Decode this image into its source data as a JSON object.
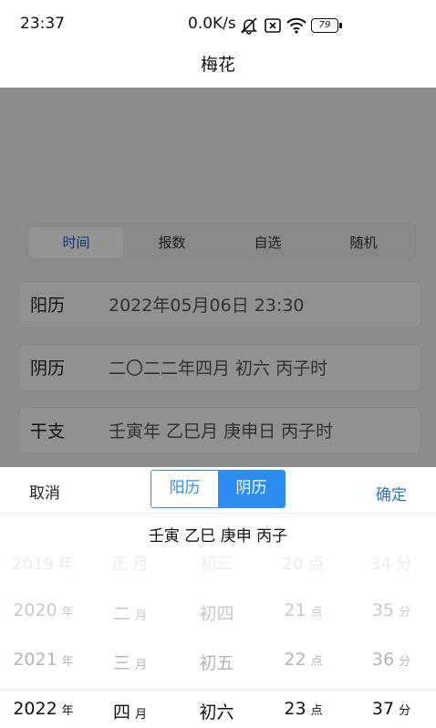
{
  "status": {
    "time": "23:37",
    "speed": "0.0K/s",
    "icons": [
      "mute-notification-icon",
      "sim-x-icon",
      "wifi-icon"
    ],
    "battery": "79"
  },
  "title": "梅花",
  "tabs": [
    {
      "label": "时间",
      "active": true
    },
    {
      "label": "报数",
      "active": false
    },
    {
      "label": "自选",
      "active": false
    },
    {
      "label": "随机",
      "active": false
    }
  ],
  "fields": {
    "solar": {
      "label": "阳历",
      "value": "2022年05月06日 23:30"
    },
    "lunar": {
      "label": "阴历",
      "value": "二〇二二年四月 初六 丙子时"
    },
    "ganzhi": {
      "label": "干支",
      "value": "壬寅年 乙巳月 庚申日 丙子时"
    }
  },
  "picker": {
    "cancel": "取消",
    "confirm": "确定",
    "segments": [
      {
        "label": "阳历",
        "active": false
      },
      {
        "label": "阴历",
        "active": true
      }
    ],
    "ganzhi_text": "壬寅 乙巳 庚申 丙子",
    "columns": {
      "year": {
        "unit": "年",
        "values": [
          "2019",
          "2020",
          "2021",
          "2022"
        ]
      },
      "month": {
        "unit": "月",
        "values": [
          "正",
          "二",
          "三",
          "四"
        ]
      },
      "day": {
        "unit": "",
        "values": [
          "初三",
          "初四",
          "初五",
          "初六"
        ]
      },
      "hour": {
        "unit": "点",
        "values": [
          "20",
          "21",
          "22",
          "23"
        ]
      },
      "minute": {
        "unit": "分",
        "values": [
          "34",
          "35",
          "36",
          "37"
        ]
      }
    }
  },
  "colors": {
    "accent": "#2d8cf0",
    "confirm": "#2a6fd0",
    "tab_active": "#1e5fb8"
  }
}
